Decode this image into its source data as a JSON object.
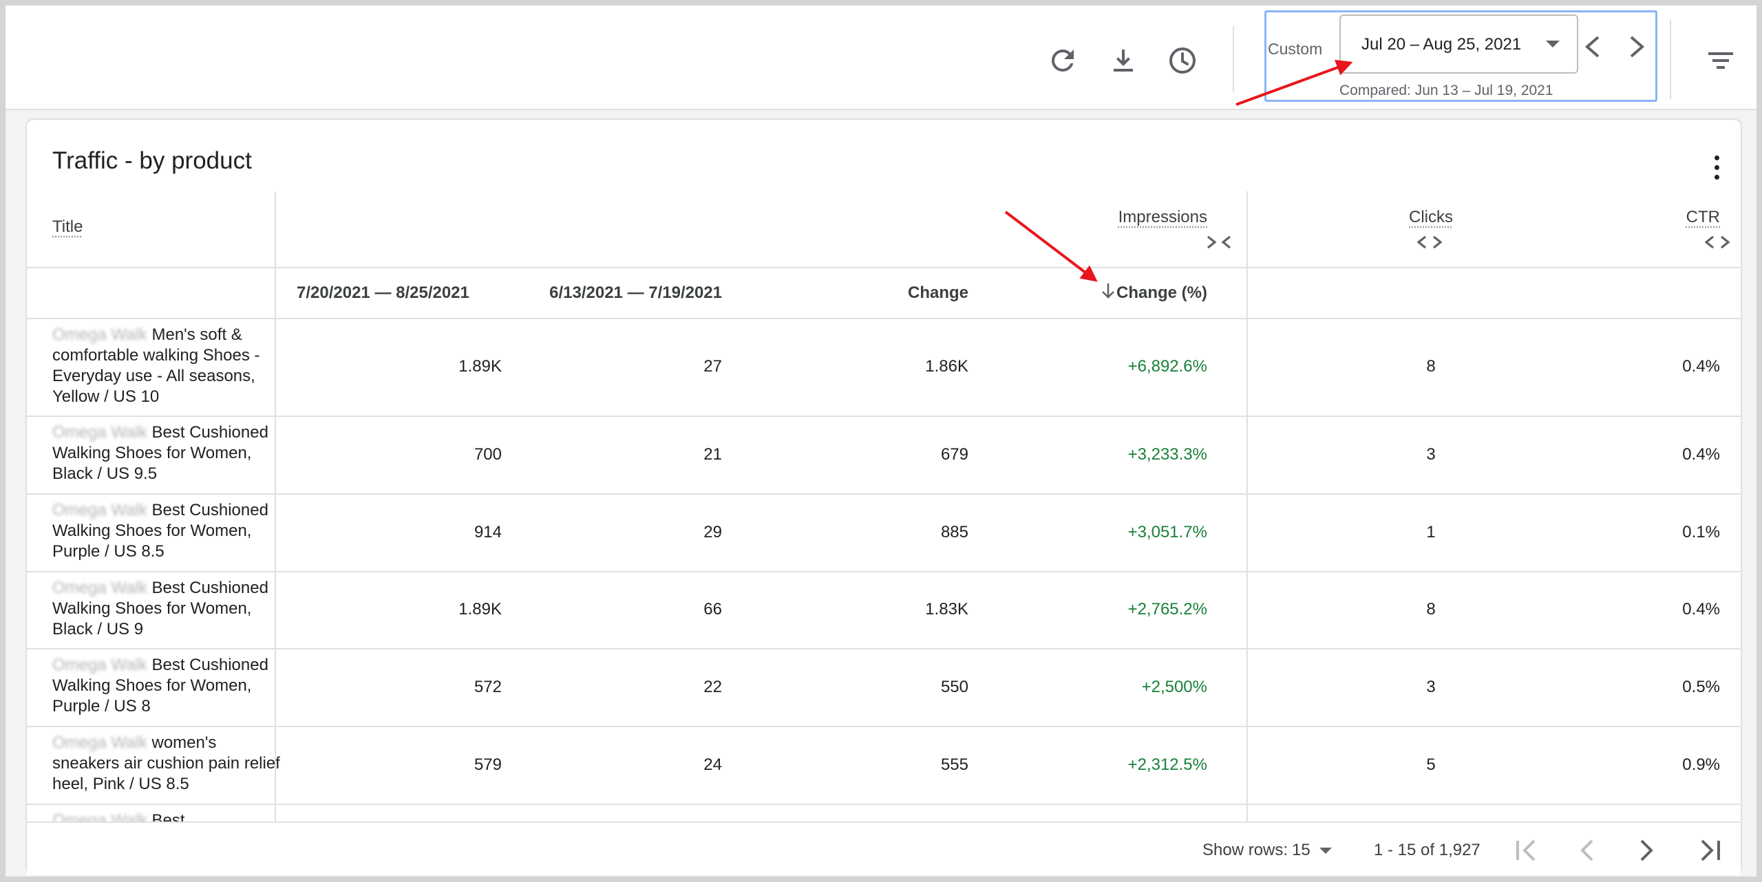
{
  "toolbar": {
    "icons": [
      "refresh-icon",
      "download-icon",
      "history-icon",
      "filter-icon"
    ],
    "date_range": {
      "mode_label": "Custom",
      "selected": "Jul 20 – Aug 25, 2021",
      "compared": "Compared: Jun 13 – Jul 19, 2021"
    }
  },
  "card": {
    "title": "Traffic - by product",
    "columns": {
      "title": "Title",
      "impressions": "Impressions",
      "clicks": "Clicks",
      "ctr": "CTR",
      "current_period": "7/20/2021 — 8/25/2021",
      "previous_period": "6/13/2021 — 7/19/2021",
      "change": "Change",
      "change_pct": "Change (%)"
    },
    "rows": [
      {
        "brand": "Omega Walk",
        "title": "Men's soft & comfortable walking Shoes - Everyday use - All seasons, Yellow / US 10",
        "current": "1.89K",
        "previous": "27",
        "change": "1.86K",
        "change_pct": "+6,892.6%",
        "clicks": "8",
        "ctr": "0.4%"
      },
      {
        "brand": "Omega Walk",
        "title": "Best Cushioned Walking Shoes for Women, Black / US 9.5",
        "current": "700",
        "previous": "21",
        "change": "679",
        "change_pct": "+3,233.3%",
        "clicks": "3",
        "ctr": "0.4%"
      },
      {
        "brand": "Omega Walk",
        "title": "Best Cushioned Walking Shoes for Women, Purple / US 8.5",
        "current": "914",
        "previous": "29",
        "change": "885",
        "change_pct": "+3,051.7%",
        "clicks": "1",
        "ctr": "0.1%"
      },
      {
        "brand": "Omega Walk",
        "title": "Best Cushioned Walking Shoes for Women, Black / US 9",
        "current": "1.89K",
        "previous": "66",
        "change": "1.83K",
        "change_pct": "+2,765.2%",
        "clicks": "8",
        "ctr": "0.4%"
      },
      {
        "brand": "Omega Walk",
        "title": "Best Cushioned Walking Shoes for Women, Purple / US 8",
        "current": "572",
        "previous": "22",
        "change": "550",
        "change_pct": "+2,500%",
        "clicks": "3",
        "ctr": "0.5%"
      },
      {
        "brand": "Omega Walk",
        "title": "women's sneakers air cushion pain relief heel, Pink / US 8.5",
        "current": "579",
        "previous": "24",
        "change": "555",
        "change_pct": "+2,312.5%",
        "clicks": "5",
        "ctr": "0.9%"
      },
      {
        "brand": "Omega Walk",
        "title": "Best",
        "current": "",
        "previous": "",
        "change": "",
        "change_pct": "",
        "clicks": "",
        "ctr": ""
      }
    ],
    "footer": {
      "show_rows_label": "Show rows:",
      "rows_per_page": "15",
      "range": "1 - 15 of 1,927"
    }
  },
  "colors": {
    "positive": "#188038",
    "annotation_arrow": "#e8161c",
    "date_box_border": "#8ab4f8"
  }
}
